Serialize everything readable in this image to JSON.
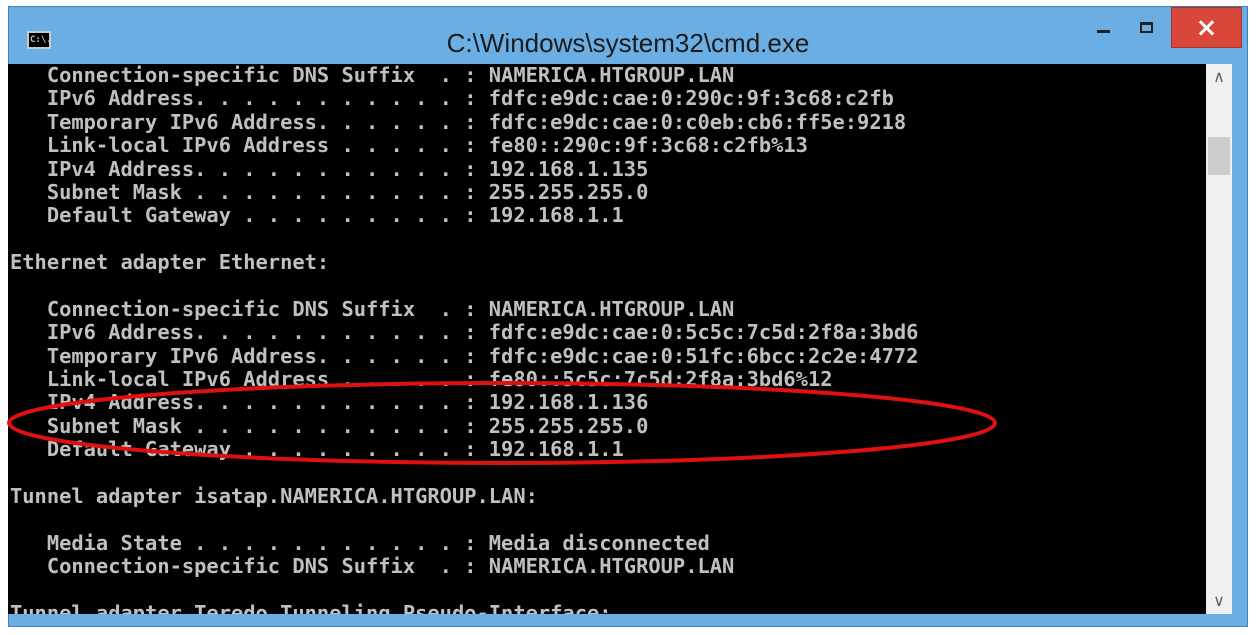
{
  "window": {
    "title": "C:\\Windows\\system32\\cmd.exe",
    "app_icon_text": "C:\\.",
    "controls": {
      "minimize": "minimize",
      "maximize": "maximize",
      "close": "×"
    }
  },
  "console": {
    "lines": [
      "   Connection-specific DNS Suffix  . : NAMERICA.HTGROUP.LAN",
      "   IPv6 Address. . . . . . . . . . . : fdfc:e9dc:cae:0:290c:9f:3c68:c2fb",
      "   Temporary IPv6 Address. . . . . . : fdfc:e9dc:cae:0:c0eb:cb6:ff5e:9218",
      "   Link-local IPv6 Address . . . . . : fe80::290c:9f:3c68:c2fb%13",
      "   IPv4 Address. . . . . . . . . . . : 192.168.1.135",
      "   Subnet Mask . . . . . . . . . . . : 255.255.255.0",
      "   Default Gateway . . . . . . . . . : 192.168.1.1",
      "",
      "Ethernet adapter Ethernet:",
      "",
      "   Connection-specific DNS Suffix  . : NAMERICA.HTGROUP.LAN",
      "   IPv6 Address. . . . . . . . . . . : fdfc:e9dc:cae:0:5c5c:7c5d:2f8a:3bd6",
      "   Temporary IPv6 Address. . . . . . : fdfc:e9dc:cae:0:51fc:6bcc:2c2e:4772",
      "   Link-local IPv6 Address . . . . . : fe80::5c5c:7c5d:2f8a:3bd6%12",
      "   IPv4 Address. . . . . . . . . . . : 192.168.1.136",
      "   Subnet Mask . . . . . . . . . . . : 255.255.255.0",
      "   Default Gateway . . . . . . . . . : 192.168.1.1",
      "",
      "Tunnel adapter isatap.NAMERICA.HTGROUP.LAN:",
      "",
      "   Media State . . . . . . . . . . . : Media disconnected",
      "   Connection-specific DNS Suffix  . : NAMERICA.HTGROUP.LAN",
      "",
      "Tunnel adapter Teredo Tunneling Pseudo-Interface:"
    ]
  },
  "scrollbar": {
    "up_icon": "chevron-up-icon",
    "down_icon": "chevron-down-icon"
  },
  "annotation": {
    "color": "#e01010"
  },
  "colors": {
    "titlebar": "#6aaee3",
    "close": "#d9473a",
    "console_bg": "#000000",
    "console_fg": "#c0c0c0"
  }
}
